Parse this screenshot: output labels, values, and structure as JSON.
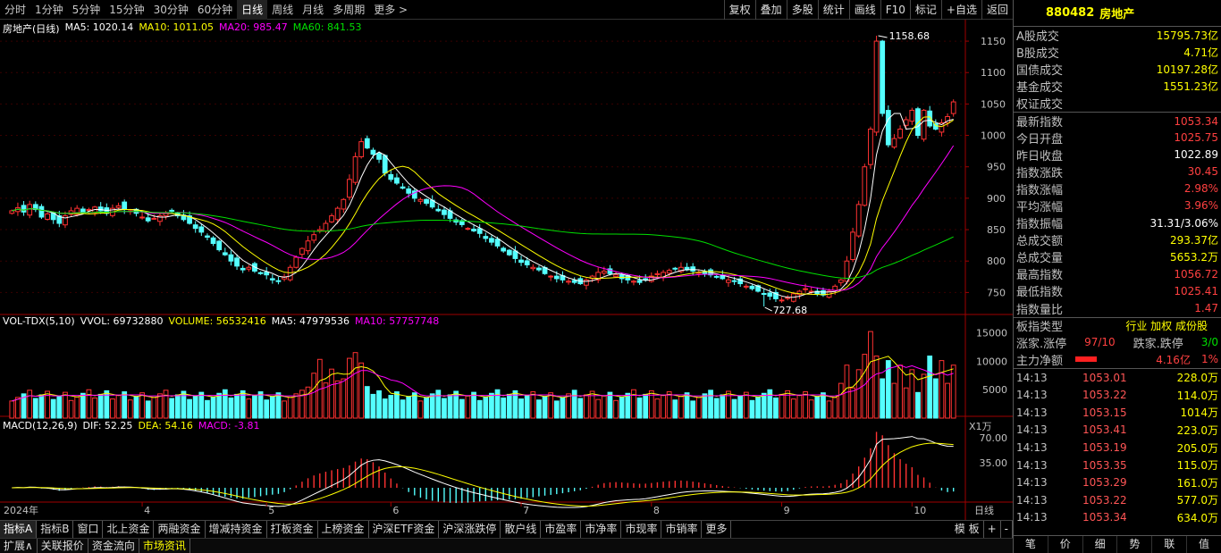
{
  "toolbar": {
    "periods": [
      "分时",
      "1分钟",
      "5分钟",
      "15分钟",
      "30分钟",
      "60分钟",
      "日线",
      "周线",
      "月线",
      "多周期",
      "更多 >"
    ],
    "active": "日线",
    "tools": [
      "复权",
      "叠加",
      "多股",
      "统计",
      "画线",
      "F10",
      "标记",
      "+自选",
      "返回"
    ]
  },
  "main_legend": {
    "title": "房地产(日线)",
    "ma5": "MA5: 1020.14",
    "ma10": "MA10: 1011.05",
    "ma20": "MA20: 985.47",
    "ma60": "MA60: 841.53"
  },
  "vol_legend": {
    "title": "VOL-TDX(5,10)",
    "vvol": "VVOL: 69732880",
    "volume": "VOLUME: 56532416",
    "ma5": "MA5: 47979536",
    "ma10": "MA10: 57757748"
  },
  "macd_legend": {
    "title": "MACD(12,26,9)",
    "dif": "DIF: 52.25",
    "dea": "DEA: 54.16",
    "macd": "MACD: -3.81"
  },
  "colors": {
    "up": "#ff3232",
    "down": "#54ffff",
    "ma5": "#ffffff",
    "ma10": "#ffff00",
    "ma20": "#ff00ff",
    "ma60": "#00e000"
  },
  "chart_data": [
    {
      "type": "candlestick",
      "title": "房地产(日线)",
      "y_ticks": [
        750,
        800,
        850,
        900,
        950,
        1000,
        1050,
        1100,
        1150
      ],
      "ylim": [
        715,
        1170
      ],
      "x_labels": [
        "2024年",
        "4",
        "5",
        "6",
        "7",
        "8",
        "9",
        "10"
      ],
      "annotations": {
        "high": "1158.68",
        "low": "727.68"
      },
      "series": [
        {
          "name": "MA5",
          "last": 1020.14
        },
        {
          "name": "MA10",
          "last": 1011.05
        },
        {
          "name": "MA20",
          "last": 985.47
        },
        {
          "name": "MA60",
          "last": 841.53
        }
      ],
      "closes": [
        880,
        885,
        878,
        890,
        882,
        870,
        875,
        866,
        860,
        872,
        880,
        884,
        878,
        882,
        886,
        880,
        876,
        884,
        888,
        882,
        880,
        876,
        870,
        864,
        868,
        872,
        876,
        880,
        872,
        866,
        860,
        852,
        846,
        838,
        828,
        818,
        810,
        800,
        792,
        786,
        790,
        784,
        780,
        778,
        770,
        768,
        775,
        790,
        806,
        820,
        832,
        842,
        850,
        860,
        872,
        884,
        898,
        930,
        966,
        990,
        980,
        970,
        962,
        940,
        930,
        924,
        916,
        908,
        900,
        898,
        892,
        886,
        880,
        874,
        868,
        862,
        858,
        852,
        848,
        844,
        836,
        830,
        824,
        816,
        810,
        804,
        798,
        794,
        790,
        786,
        780,
        776,
        772,
        770,
        768,
        766,
        764,
        770,
        776,
        782,
        784,
        780,
        778,
        772,
        770,
        768,
        766,
        770,
        776,
        780,
        782,
        785,
        788,
        790,
        786,
        784,
        782,
        780,
        778,
        775,
        772,
        770,
        768,
        764,
        760,
        756,
        752,
        748,
        744,
        740,
        738,
        742,
        748,
        752,
        756,
        752,
        748,
        746,
        752,
        760,
        770,
        800,
        846,
        890,
        950,
        1010,
        1150,
        1035,
        985,
        995,
        1010,
        1025,
        1040,
        1000,
        1040,
        1015,
        1010,
        1020,
        1030,
        1053.34
      ]
    },
    {
      "type": "bar",
      "title": "VOL-TDX(5,10)",
      "y_ticks": [
        5000,
        10000,
        15000
      ],
      "ylim": [
        0,
        16000
      ],
      "unit": "X1万"
    },
    {
      "type": "line",
      "title": "MACD(12,26,9)",
      "y_ticks": [
        35.0,
        70.0
      ],
      "ylim": [
        -20,
        80
      ]
    }
  ],
  "right": {
    "code": "880482",
    "name": "房地产",
    "stats": [
      {
        "l": "A股成交",
        "v": "15795.73亿",
        "c": "yel"
      },
      {
        "l": "B股成交",
        "v": "4.71亿",
        "c": "yel"
      },
      {
        "l": "国债成交",
        "v": "10197.28亿",
        "c": "yel"
      },
      {
        "l": "基金成交",
        "v": "1551.23亿",
        "c": "yel"
      },
      {
        "l": "权证成交",
        "v": "",
        "c": "yel"
      },
      {
        "l": "最新指数",
        "v": "1053.34",
        "c": "red"
      },
      {
        "l": "今日开盘",
        "v": "1025.75",
        "c": "red"
      },
      {
        "l": "昨日收盘",
        "v": "1022.89",
        "c": "wht"
      },
      {
        "l": "指数涨跌",
        "v": "30.45",
        "c": "red"
      },
      {
        "l": "指数涨幅",
        "v": "2.98%",
        "c": "red"
      },
      {
        "l": "平均涨幅",
        "v": "3.96%",
        "c": "red"
      },
      {
        "l": "指数振幅",
        "v": "31.31/3.06%",
        "c": "wht"
      },
      {
        "l": "总成交额",
        "v": "293.37亿",
        "c": "yel"
      },
      {
        "l": "总成交量",
        "v": "5653.2万",
        "c": "yel"
      },
      {
        "l": "最高指数",
        "v": "1056.72",
        "c": "red"
      },
      {
        "l": "最低指数",
        "v": "1025.41",
        "c": "red"
      },
      {
        "l": "指数量比",
        "v": "1.47",
        "c": "red"
      }
    ],
    "type_label": "板指类型",
    "type_value": "行业 加权 成份股",
    "rise_label": "涨家.涨停",
    "rise_value": "97/10",
    "fall_label": "跌家.跌停",
    "fall_value": "3/0",
    "flow_label": "主力净额",
    "flow_value": "4.16亿",
    "flow_pct": "1%",
    "ticks": [
      [
        "14:13",
        "1053.01",
        "228.0万"
      ],
      [
        "14:13",
        "1053.22",
        "114.0万"
      ],
      [
        "14:13",
        "1053.15",
        "1014万"
      ],
      [
        "14:13",
        "1053.41",
        "223.0万"
      ],
      [
        "14:13",
        "1053.19",
        "205.0万"
      ],
      [
        "14:13",
        "1053.35",
        "115.0万"
      ],
      [
        "14:13",
        "1053.29",
        "161.0万"
      ],
      [
        "14:13",
        "1053.22",
        "577.0万"
      ],
      [
        "14:13",
        "1053.34",
        "634.0万"
      ]
    ],
    "footer": [
      "笔",
      "价",
      "细",
      "势",
      "联",
      "值"
    ]
  },
  "index_tabs": [
    "指标A",
    "指标B",
    "窗口",
    "北上资金",
    "两融资金",
    "增减持资金",
    "打板资金",
    "上榜资金",
    "沪深ETF资金",
    "沪深涨跌停",
    "散户线",
    "市盈率",
    "市净率",
    "市现率",
    "市销率",
    "更多"
  ],
  "index_right": {
    "label": "模 板",
    "plus": "+",
    "minus": "-",
    "x_unit": "日线"
  },
  "bottom_tabs": [
    "扩展∧",
    "关联报价",
    "资金流向",
    "市场资讯"
  ],
  "bottom_active": "市场资讯"
}
